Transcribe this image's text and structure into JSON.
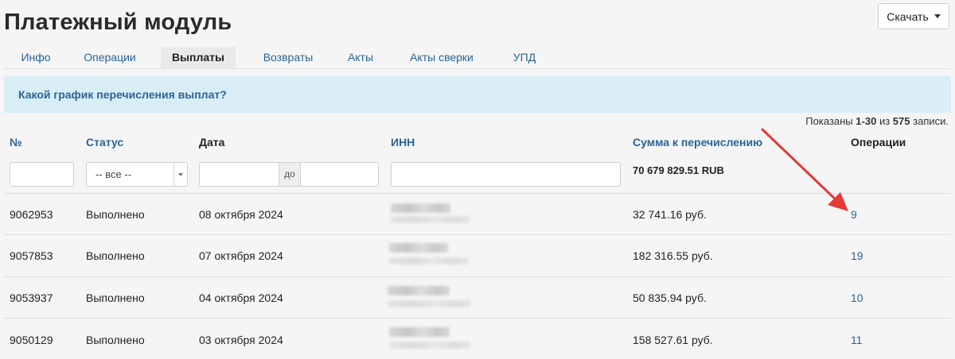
{
  "page": {
    "title": "Платежный модуль"
  },
  "toolbar": {
    "download_label": "Скачать"
  },
  "tabs": [
    {
      "label": "Инфо",
      "active": false
    },
    {
      "label": "Операции",
      "active": false
    },
    {
      "label": "Выплаты",
      "active": true
    },
    {
      "label": "Возвраты",
      "active": false
    },
    {
      "label": "Акты",
      "active": false
    },
    {
      "label": "Акты сверки",
      "active": false
    },
    {
      "label": "УПД",
      "active": false
    }
  ],
  "info": {
    "link_text": "Какой график перечисления выплат?"
  },
  "summary": {
    "prefix": "Показаны",
    "range": "1-30",
    "middle": "из",
    "total": "575",
    "suffix": "записи."
  },
  "table": {
    "headers": {
      "number": "№",
      "status": "Статус",
      "date": "Дата",
      "inn": "ИНН",
      "amount": "Сумма к перечислению",
      "operations": "Операции"
    },
    "filters": {
      "status_selected": "-- все --",
      "date_separator": "до",
      "total_amount": "70 679 829.51 RUB"
    },
    "rows": [
      {
        "id": "9062953",
        "status": "Выполнено",
        "date": "08 октября 2024",
        "amount": "32 741.16 руб.",
        "operations": "9"
      },
      {
        "id": "9057853",
        "status": "Выполнено",
        "date": "07 октября 2024",
        "amount": "182 316.55 руб.",
        "operations": "19"
      },
      {
        "id": "9053937",
        "status": "Выполнено",
        "date": "04 октября 2024",
        "amount": "50 835.94 руб.",
        "operations": "10"
      },
      {
        "id": "9050129",
        "status": "Выполнено",
        "date": "03 октября 2024",
        "amount": "158 527.61 руб.",
        "operations": "11"
      }
    ]
  },
  "annotation": {
    "arrow_color": "#e53935"
  },
  "colors": {
    "link": "#2a6496",
    "info_background": "#d9edf7",
    "page_background": "#f5f5f5"
  }
}
